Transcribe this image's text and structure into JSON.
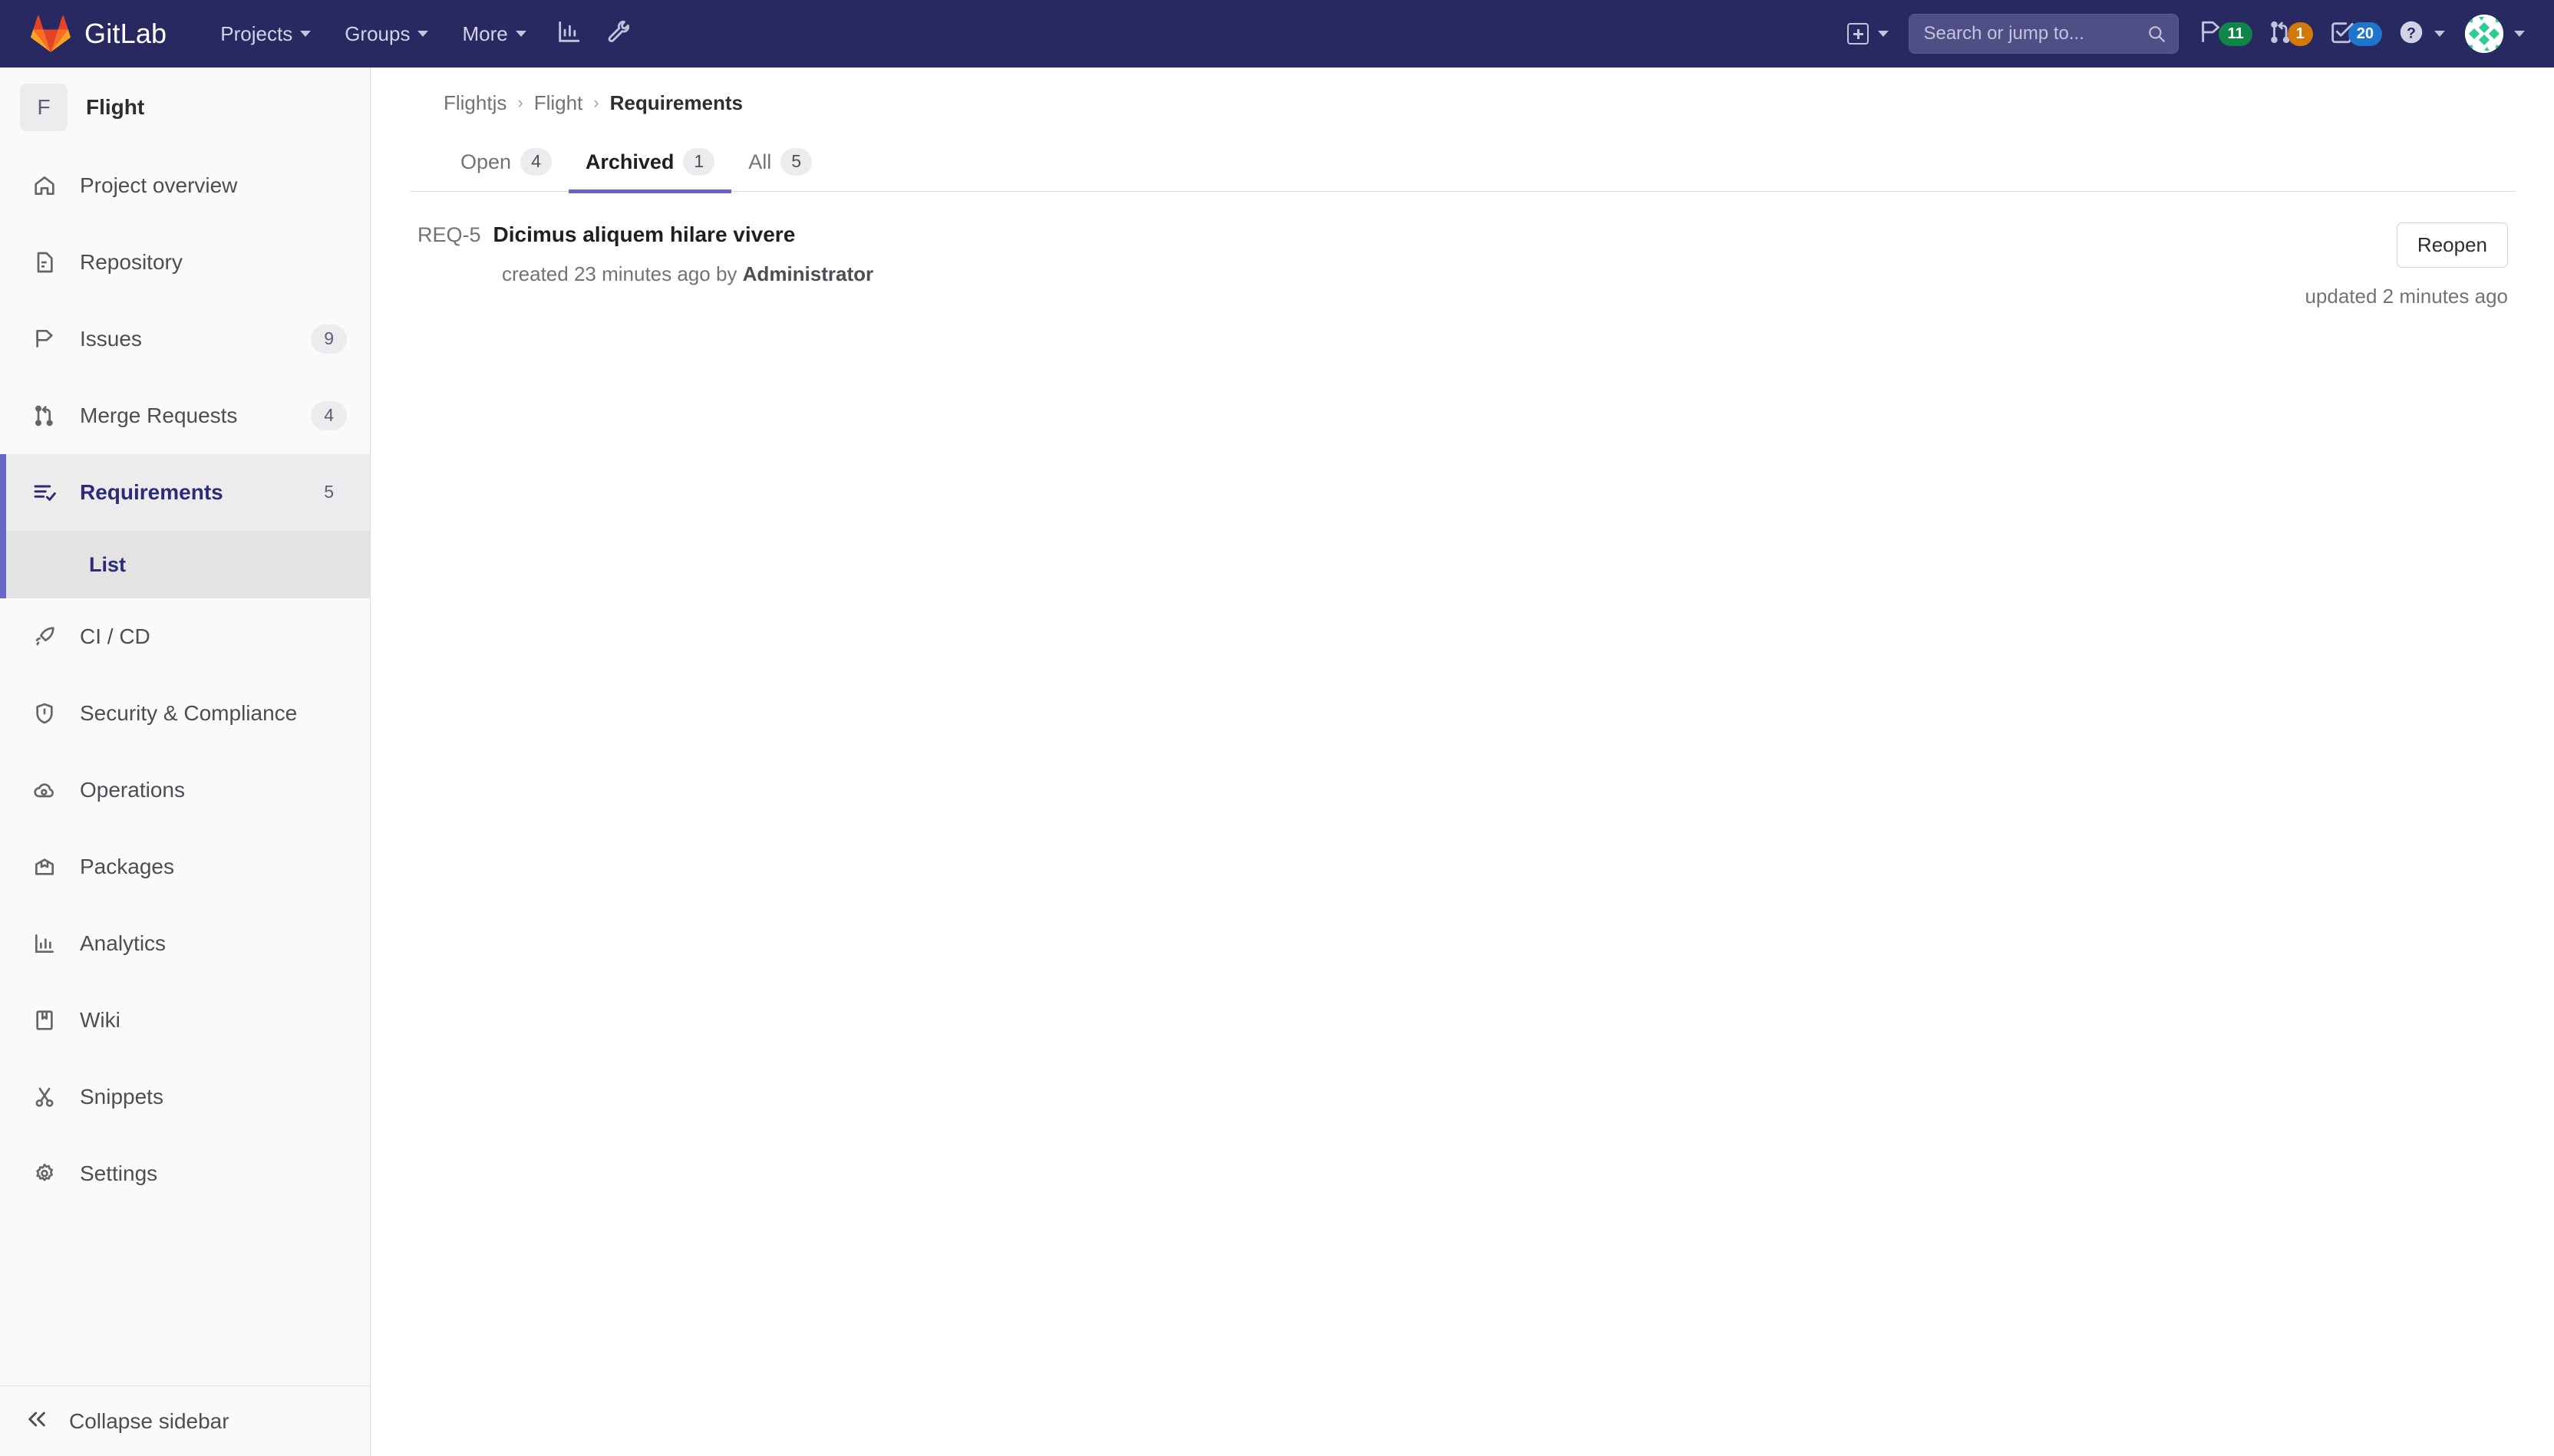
{
  "navbar": {
    "brand": "GitLab",
    "logo_icon": "gitlab-tanuki-logo",
    "menu": [
      {
        "label": "Projects",
        "has_caret": true
      },
      {
        "label": "Groups",
        "has_caret": true
      },
      {
        "label": "More",
        "has_caret": true
      }
    ],
    "icon_buttons": [
      {
        "name": "analytics-chart-icon"
      },
      {
        "name": "wrench-admin-icon"
      }
    ],
    "new_button": {
      "name": "new-plus-icon",
      "has_caret": true
    },
    "search": {
      "placeholder": "Search or jump to...",
      "value": ""
    },
    "indicators": [
      {
        "name": "issues-icon",
        "count": "11",
        "color": "#108548"
      },
      {
        "name": "merge-requests-icon",
        "count": "1",
        "color": "#d3790a"
      },
      {
        "name": "todos-icon",
        "count": "20",
        "color": "#1f75cb"
      }
    ],
    "help": {
      "name": "help-question-icon",
      "has_caret": true
    },
    "user": {
      "name": "user-avatar",
      "has_caret": true
    }
  },
  "sidebar": {
    "project": {
      "initial": "F",
      "name": "Flight"
    },
    "items": [
      {
        "label": "Project overview",
        "icon": "home-icon",
        "count": ""
      },
      {
        "label": "Repository",
        "icon": "document-icon",
        "count": ""
      },
      {
        "label": "Issues",
        "icon": "issues-icon",
        "count": "9"
      },
      {
        "label": "Merge Requests",
        "icon": "merge-request-icon",
        "count": "4"
      },
      {
        "label": "Requirements",
        "icon": "requirements-icon",
        "count": "5",
        "active": true
      },
      {
        "label": "CI / CD",
        "icon": "rocket-icon",
        "count": ""
      },
      {
        "label": "Security & Compliance",
        "icon": "shield-icon",
        "count": ""
      },
      {
        "label": "Operations",
        "icon": "cloud-gear-icon",
        "count": ""
      },
      {
        "label": "Packages",
        "icon": "package-icon",
        "count": ""
      },
      {
        "label": "Analytics",
        "icon": "chart-icon",
        "count": ""
      },
      {
        "label": "Wiki",
        "icon": "book-icon",
        "count": ""
      },
      {
        "label": "Snippets",
        "icon": "scissors-icon",
        "count": ""
      },
      {
        "label": "Settings",
        "icon": "gear-icon",
        "count": ""
      }
    ],
    "subitem": {
      "label": "List"
    },
    "footer": {
      "label": "Collapse sidebar",
      "icon": "chevron-double-left-icon"
    }
  },
  "breadcrumb": {
    "group": "Flightjs",
    "project": "Flight",
    "current": "Requirements",
    "separator": "›"
  },
  "tabs": [
    {
      "label": "Open",
      "count": "4",
      "active": false
    },
    {
      "label": "Archived",
      "count": "1",
      "active": true
    },
    {
      "label": "All",
      "count": "5",
      "active": false
    }
  ],
  "requirements": [
    {
      "id": "REQ-5",
      "title": "Dicimus aliquem hilare vivere",
      "created_prefix": "created 23 minutes ago by",
      "author": "Administrator",
      "action_label": "Reopen",
      "updated": "updated 2 minutes ago"
    }
  ],
  "colors": {
    "navbar_bg": "#292961",
    "accent": "#6666c4",
    "active_text": "#2b2b78",
    "sidebar_bg": "#fafafa"
  }
}
